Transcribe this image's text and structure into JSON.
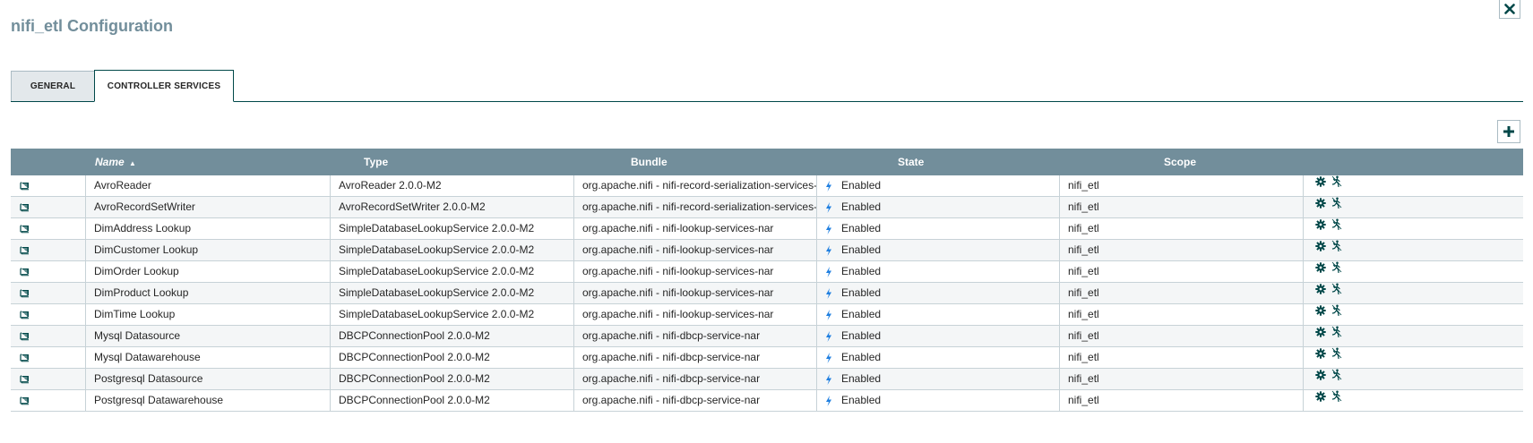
{
  "dialog": {
    "title": "nifi_etl Configuration",
    "close_icon": "close-icon"
  },
  "tabs": [
    {
      "label": "GENERAL",
      "active": false
    },
    {
      "label": "CONTROLLER SERVICES",
      "active": true
    }
  ],
  "toolbar": {
    "add_icon": "plus-icon"
  },
  "grid": {
    "columns": {
      "name": "Name",
      "type": "Type",
      "bundle": "Bundle",
      "state": "State",
      "scope": "Scope"
    },
    "sort_indicator": "▲",
    "rows": [
      {
        "name": "AvroReader",
        "type": "AvroReader 2.0.0-M2",
        "bundle": "org.apache.nifi - nifi-record-serialization-services-nar",
        "state": "Enabled",
        "scope": "nifi_etl"
      },
      {
        "name": "AvroRecordSetWriter",
        "type": "AvroRecordSetWriter 2.0.0-M2",
        "bundle": "org.apache.nifi - nifi-record-serialization-services-nar",
        "state": "Enabled",
        "scope": "nifi_etl"
      },
      {
        "name": "DimAddress Lookup",
        "type": "SimpleDatabaseLookupService 2.0.0-M2",
        "bundle": "org.apache.nifi - nifi-lookup-services-nar",
        "state": "Enabled",
        "scope": "nifi_etl"
      },
      {
        "name": "DimCustomer Lookup",
        "type": "SimpleDatabaseLookupService 2.0.0-M2",
        "bundle": "org.apache.nifi - nifi-lookup-services-nar",
        "state": "Enabled",
        "scope": "nifi_etl"
      },
      {
        "name": "DimOrder Lookup",
        "type": "SimpleDatabaseLookupService 2.0.0-M2",
        "bundle": "org.apache.nifi - nifi-lookup-services-nar",
        "state": "Enabled",
        "scope": "nifi_etl"
      },
      {
        "name": "DimProduct Lookup",
        "type": "SimpleDatabaseLookupService 2.0.0-M2",
        "bundle": "org.apache.nifi - nifi-lookup-services-nar",
        "state": "Enabled",
        "scope": "nifi_etl"
      },
      {
        "name": "DimTime Lookup",
        "type": "SimpleDatabaseLookupService 2.0.0-M2",
        "bundle": "org.apache.nifi - nifi-lookup-services-nar",
        "state": "Enabled",
        "scope": "nifi_etl"
      },
      {
        "name": "Mysql Datasource",
        "type": "DBCPConnectionPool 2.0.0-M2",
        "bundle": "org.apache.nifi - nifi-dbcp-service-nar",
        "state": "Enabled",
        "scope": "nifi_etl"
      },
      {
        "name": "Mysql Datawarehouse",
        "type": "DBCPConnectionPool 2.0.0-M2",
        "bundle": "org.apache.nifi - nifi-dbcp-service-nar",
        "state": "Enabled",
        "scope": "nifi_etl"
      },
      {
        "name": "Postgresql Datasource",
        "type": "DBCPConnectionPool 2.0.0-M2",
        "bundle": "org.apache.nifi - nifi-dbcp-service-nar",
        "state": "Enabled",
        "scope": "nifi_etl"
      },
      {
        "name": "Postgresql Datawarehouse",
        "type": "DBCPConnectionPool 2.0.0-M2",
        "bundle": "org.apache.nifi - nifi-dbcp-service-nar",
        "state": "Enabled",
        "scope": "nifi_etl"
      }
    ],
    "row_icons": {
      "info": "book-icon",
      "state": "lightning-bolt-icon",
      "configure": "gear-icon",
      "disable": "disable-icon"
    }
  },
  "colors": {
    "header_bg": "#728e9b",
    "title": "#728e9b",
    "accent": "#004849",
    "state_icon": "#1f7fe0"
  }
}
